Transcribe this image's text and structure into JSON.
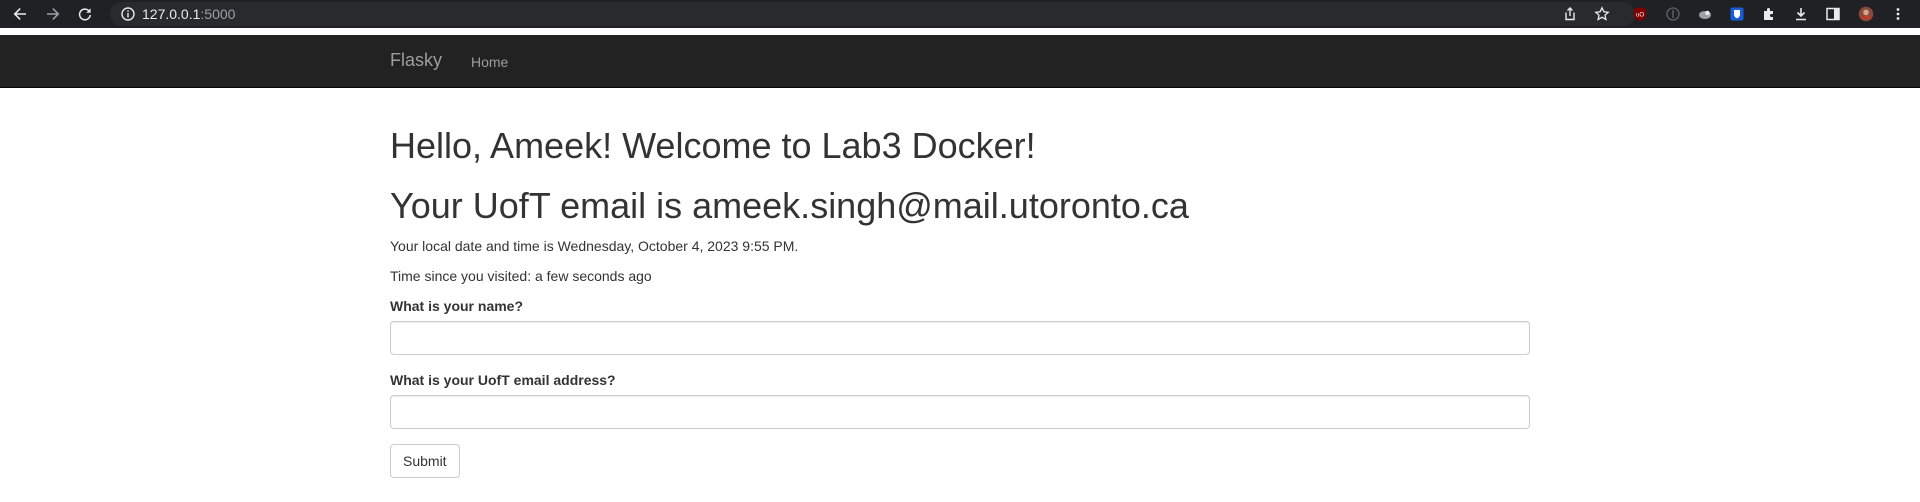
{
  "browser": {
    "url_host": "127.0.0.1",
    "url_port": ":5000",
    "icons": [
      "back-arrow-icon",
      "forward-arrow-icon",
      "reload-icon",
      "info-icon",
      "share-icon",
      "bookmark-star-icon",
      "ublock-icon",
      "extension-icon",
      "extension-icon",
      "bitwarden-icon",
      "puzzle-icon",
      "download-icon",
      "side-panel-icon",
      "profile-avatar-icon",
      "kebab-menu-icon"
    ]
  },
  "navbar": {
    "brand": "Flasky",
    "home": "Home",
    "background": "#222222"
  },
  "main": {
    "greeting": "Hello, Ameek! Welcome to Lab3 Docker!",
    "email_line": "Your UofT email is ameek.singh@mail.utoronto.ca",
    "local_time": "Your local date and time is Wednesday, October 4, 2023 9:55 PM.",
    "time_since": "Time since you visited: a few seconds ago"
  },
  "form": {
    "name_label": "What is your name?",
    "name_value": "",
    "email_label": "What is your UofT email address?",
    "email_value": "",
    "submit_label": "Submit"
  }
}
